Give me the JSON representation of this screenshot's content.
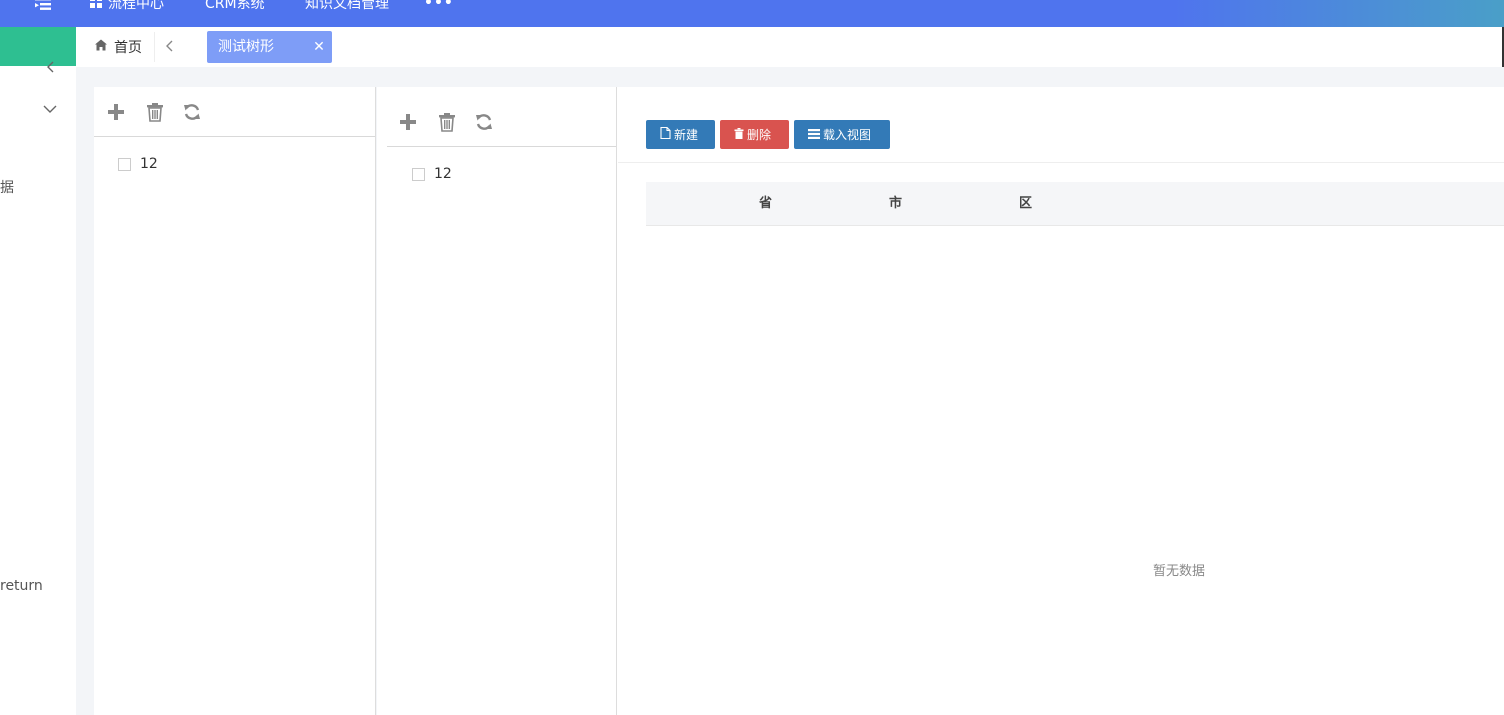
{
  "topbar": {
    "nav": [
      {
        "label": "流程中心",
        "icon": "grid-icon"
      },
      {
        "label": "CRM系统"
      },
      {
        "label": "知识文档管理"
      },
      {
        "label": "•••"
      }
    ],
    "accent_color": "#4f74ee"
  },
  "sidebar": {
    "active_color": "#2ebf91",
    "text_fragment_1": "据",
    "text_fragment_2": "return"
  },
  "tabs": {
    "home_label": "首页",
    "active_tab_label": "测试树形",
    "close_glyph": "✕"
  },
  "tree_panels": [
    {
      "toolbar": [
        "add-icon",
        "trash-icon",
        "refresh-icon"
      ],
      "nodes": [
        {
          "label": "12",
          "checked": false
        }
      ]
    },
    {
      "toolbar": [
        "add-icon",
        "trash-icon",
        "refresh-icon"
      ],
      "nodes": [
        {
          "label": "12",
          "checked": false
        }
      ]
    }
  ],
  "grid": {
    "buttons": {
      "new": "新建",
      "delete": "删除",
      "load_view": "载入视图"
    },
    "button_colors": {
      "primary": "#337ab7",
      "danger": "#d9534f"
    },
    "columns": [
      "省",
      "市",
      "区"
    ],
    "empty_text": "暂无数据"
  }
}
